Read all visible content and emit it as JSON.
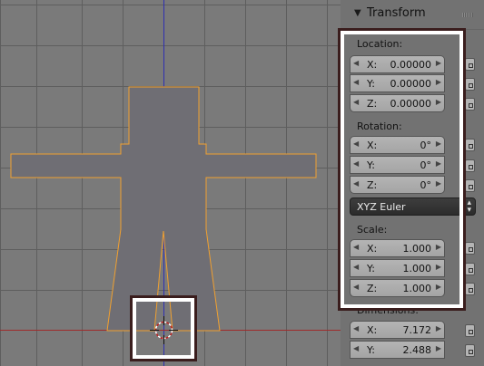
{
  "panel": {
    "header": {
      "title": "Transform"
    },
    "location": {
      "label": "Location:",
      "fields": [
        {
          "axis": "X:",
          "value": "0.00000"
        },
        {
          "axis": "Y:",
          "value": "0.00000"
        },
        {
          "axis": "Z:",
          "value": "0.00000"
        }
      ]
    },
    "rotation": {
      "label": "Rotation:",
      "fields": [
        {
          "axis": "X:",
          "value": "0°"
        },
        {
          "axis": "Y:",
          "value": "0°"
        },
        {
          "axis": "Z:",
          "value": "0°"
        }
      ],
      "mode": "XYZ Euler"
    },
    "scale": {
      "label": "Scale:",
      "fields": [
        {
          "axis": "X:",
          "value": "1.000"
        },
        {
          "axis": "Y:",
          "value": "1.000"
        },
        {
          "axis": "Z:",
          "value": "1.000"
        }
      ]
    },
    "dimensions": {
      "label": "Dimensions:",
      "fields": [
        {
          "axis": "X:",
          "value": "7.172"
        },
        {
          "axis": "Y:",
          "value": "2.488"
        }
      ]
    }
  },
  "icons": {
    "collapse": "triangle-down-icon",
    "grip": "drag-grip-icon",
    "lock": "lock-icon",
    "cursor": "3d-cursor-icon"
  },
  "colors": {
    "grid_background": "#7a7a7a",
    "grid_lines": "#5e5e5e",
    "x_axis": "#9e2b2b",
    "z_axis": "#2f2fb0",
    "mesh_fill": "#6f6e74",
    "selection_outline": "#f0a030",
    "panel_background": "#727272",
    "field_background": "#ababab",
    "dropdown_background": "#323232",
    "highlight_border": "#ffffff",
    "highlight_outline": "#3a1d1d"
  }
}
